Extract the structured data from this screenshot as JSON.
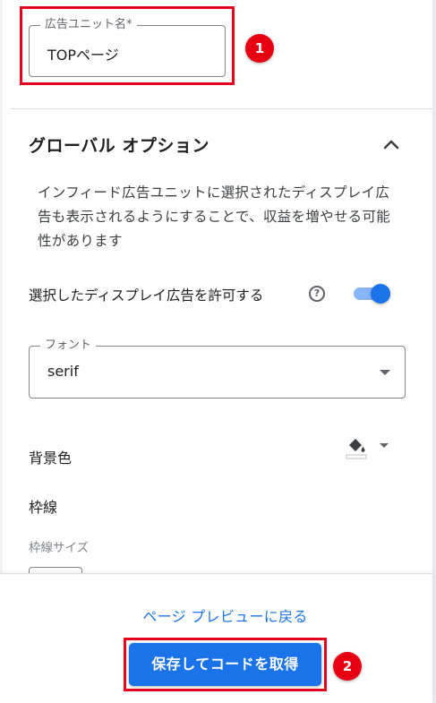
{
  "ad_unit_name": {
    "label": "広告ユニット名*",
    "value": "TOPページ"
  },
  "global_options": {
    "title": "グローバル オプション",
    "description": "インフィード広告ユニットに選択されたディスプレイ広告も表示されるようにすることで、収益を増やせる可能性があります",
    "allow_display_ads_label": "選択したディスプレイ広告を許可する",
    "allow_display_ads_enabled": true
  },
  "font": {
    "label": "フォント",
    "value": "serif"
  },
  "background_color": {
    "label": "背景色"
  },
  "border": {
    "label": "枠線",
    "size_label": "枠線サイズ"
  },
  "footer": {
    "back_to_preview": "ページ プレビューに戻る",
    "save_button": "保存してコードを取得"
  },
  "annotations": {
    "badge_1": "1",
    "badge_2": "2"
  },
  "icons": {
    "collapse": "chevron-up-icon",
    "help": "help-circle-icon",
    "font_dropdown": "arrow-drop-down-icon",
    "color_picker": "paint-bucket-icon"
  },
  "colors": {
    "accent": "#1a73e8",
    "highlight": "#e5001d"
  }
}
